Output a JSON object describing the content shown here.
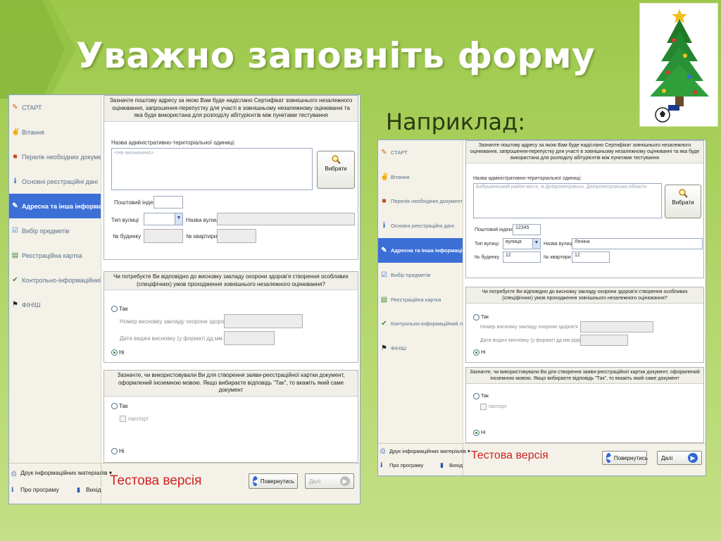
{
  "slide": {
    "title": "Уважно заповніть форму",
    "subtitle": "Наприклад:",
    "colors": {
      "background": "#a9d05c",
      "title": "#ffffff",
      "accent": "#3c6fd6",
      "test_version": "#d02222"
    },
    "decoration_icon": "christmas-tree-icon"
  },
  "nav": [
    {
      "label": "СТАРТ",
      "icon": "start-icon"
    },
    {
      "label": "Вітання",
      "icon": "greeting-icon"
    },
    {
      "label": "Перелік необхідних документів",
      "icon": "documents-icon"
    },
    {
      "label": "Основні реєстраційні дані",
      "icon": "info-icon"
    },
    {
      "label": "Адресна та інша інформація",
      "icon": "address-icon",
      "active": true
    },
    {
      "label": "Вибір предметів",
      "icon": "subjects-icon"
    },
    {
      "label": "Реєстраційна картка",
      "icon": "card-icon"
    },
    {
      "label": "Контрольно-інформаційний лист",
      "icon": "control-sheet-icon"
    },
    {
      "label": "ФІНІШ",
      "icon": "finish-flag-icon"
    }
  ],
  "footer": {
    "print": "Друк інформаційних матеріалів ▾",
    "about": "Про програму",
    "exit": "Вихід",
    "test_version": "Тестова версія",
    "back": "Повернутись",
    "next": "Далі"
  },
  "form": {
    "address_header": "Зазначте поштову адресу за якою Вам буде надіслано Сертифікат зовнішнього незалежного оцінювання, запрошення-перепустку для участі в зовнішньому незалежному оцінюванні та яка буде використана для розподілу абітурієнтів між пунктами тестування",
    "admin_unit_label": "Назва адміністративно-територіальної одиниці:",
    "choose_button": "Вибрати",
    "postal_index_label": "Поштовий індекс",
    "street_type_label": "Тип вулиці",
    "street_name_label": "Назва вулиці",
    "house_label": "№ будинку",
    "apartment_label": "№ квартири",
    "health_header": "Чи потребуєте Ви відповідно до висновку закладу охорони здоров'я створення особливих (спеціфічних) умов проходження зовнішнього незалежного оцінювання?",
    "yes_label": "Так",
    "no_label": "Ні",
    "conclusion_number_label": "Номер висновку закладу охорони здоров'я",
    "conclusion_date_label": "Дата видачі висновку (у форматі дд.мм.рррр)",
    "document_header": "Зазначте, чи використовували Ви для створення заяви-реєстраційної картки документ, оформлений іноземною мовою. Якщо вибираєте відповідь \"Так\", то вкажіть який саме документ",
    "passport_label": "паспорт"
  },
  "empty_form": {
    "admin_unit_value": "<Не визначено>",
    "postal_index": "",
    "street_type": "",
    "street_name": "",
    "house": "",
    "apartment": ""
  },
  "example_form": {
    "admin_unit_value": "Бабушкінський район міста, м.Дніпропетровськ, Дніпропетровська область",
    "postal_index": "12345",
    "street_type": "вулиця",
    "street_name": "Леніна",
    "house": "12",
    "apartment": "12"
  }
}
